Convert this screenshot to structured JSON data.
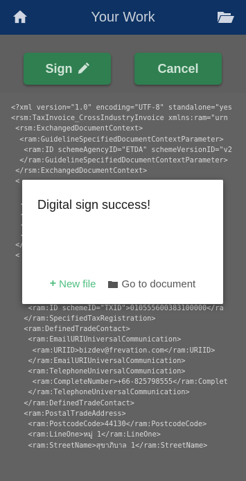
{
  "header": {
    "title": "Your Work",
    "home_icon": "home-icon",
    "folder_icon": "folder-open-icon"
  },
  "toolbar": {
    "sign_label": "Sign",
    "cancel_label": "Cancel"
  },
  "xml_lines": [
    "<?xml version=\"1.0\" encoding=\"UTF-8\" standalone=\"yes",
    "<rsm:TaxInvoice_CrossIndustryInvoice xmlns:ram=\"urn",
    " <rsm:ExchangedDocumentContext>",
    "  <ram:GuidelineSpecifiedDocumentContextParameter>",
    "   <ram:ID schemeAgencyID=\"ETDA\" schemeVersionID=\"v2",
    "  </ram:GuidelineSpecifiedDocumentContextParameter>",
    " </rsm:ExchangedDocumentContext>",
    " <",
    "",
    "  .",
    "  .                                         ram:I",
    "  .                                         Z</r",
    "  .",
    " </",
    " <",
    "",
    "",
    "",
    "   <ram:SpecifiedTaxRegistration>",
    "    <ram:ID schemeID=\"TXID\">010555600383100000</ra",
    "   </ram:SpecifiedTaxRegistration>",
    "   <ram:DefinedTradeContact>",
    "    <ram:EmailURIUniversalCommunication>",
    "     <ram:URIID>bizdev@frevation.com</ram:URIID>",
    "    </ram:EmailURIUniversalCommunication>",
    "    <ram:TelephoneUniversalCommunication>",
    "     <ram:CompleteNumber>+66-825798555</ram:Complet",
    "    </ram:TelephoneUniversalCommunication>",
    "   </ram:DefinedTradeContact>",
    "   <ram:PostalTradeAddress>",
    "    <ram:PostcodeCode>44130</ram:PostcodeCode>",
    "    <ram:LineOne>หมู่ 1</ram:LineOne>",
    "    <ram:StreetName>สุขาภิบาล 1</ram:StreetName>"
  ],
  "dialog": {
    "message": "Digital sign success!",
    "new_file_label": "New file",
    "go_to_document_label": "Go to document"
  }
}
